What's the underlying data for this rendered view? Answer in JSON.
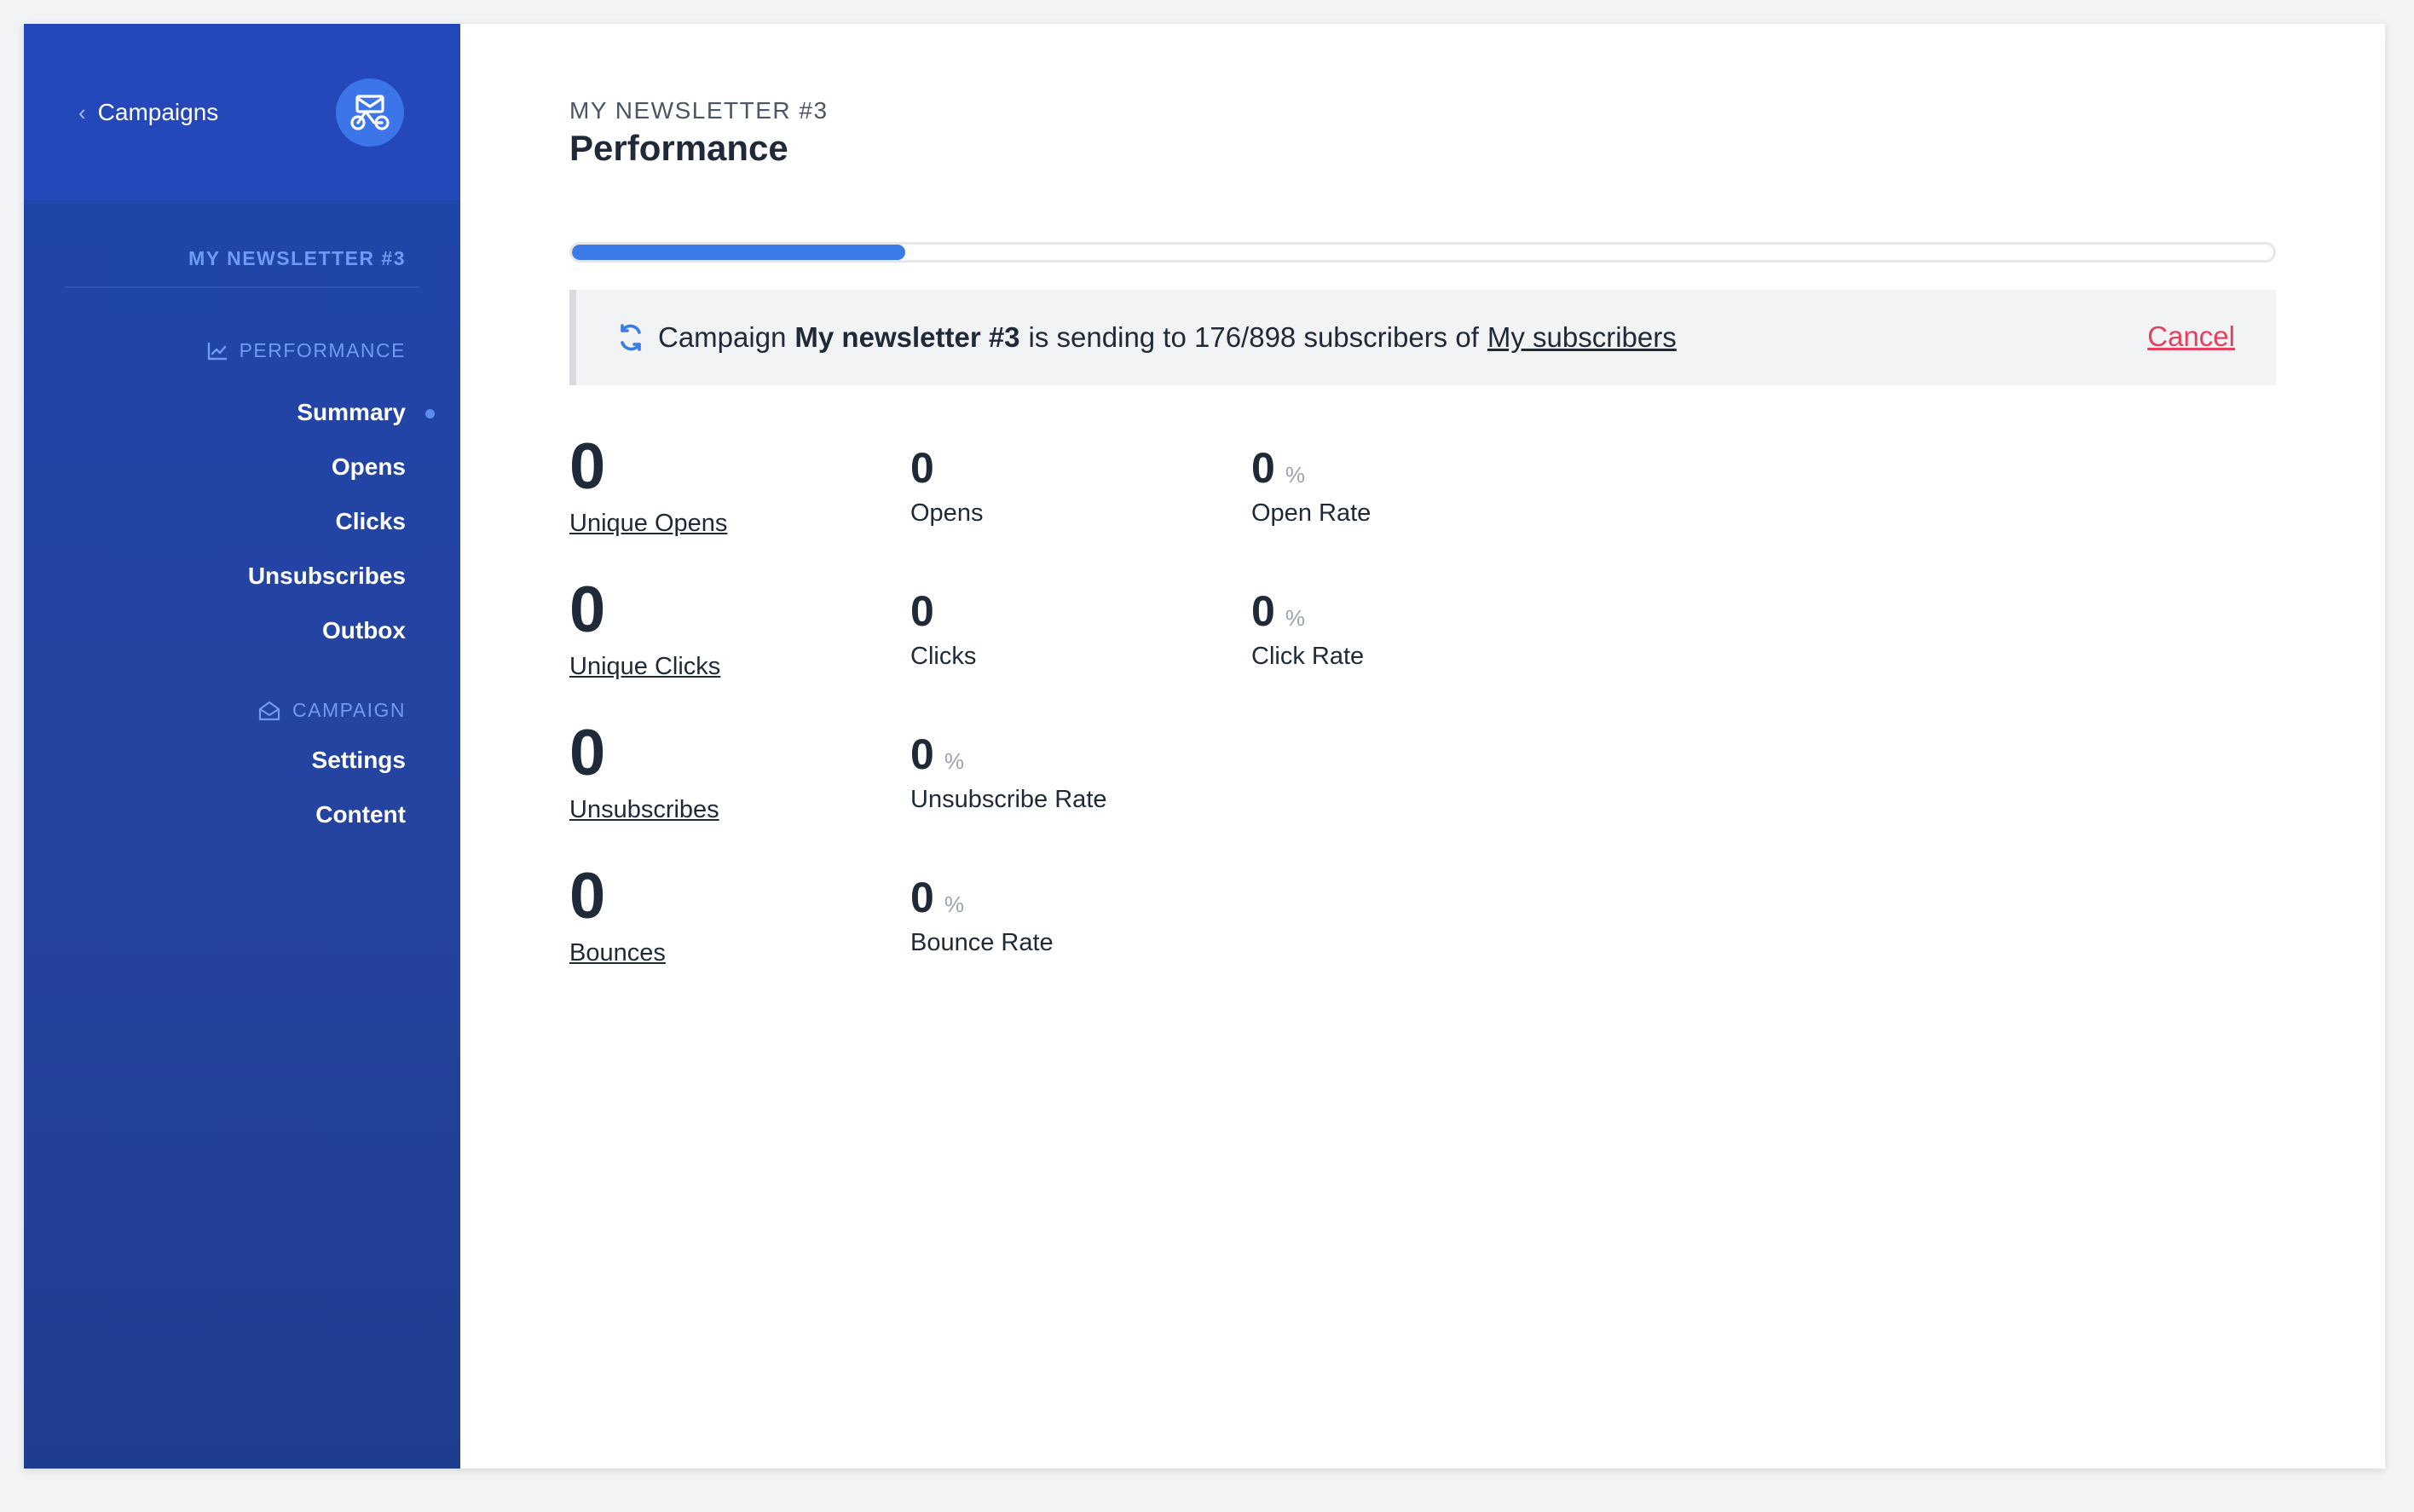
{
  "sidebar": {
    "back_label": "Campaigns",
    "newsletter_name": "MY NEWSLETTER #3",
    "sections": [
      {
        "title": "PERFORMANCE",
        "items": [
          {
            "label": "Summary",
            "active": true
          },
          {
            "label": "Opens"
          },
          {
            "label": "Clicks"
          },
          {
            "label": "Unsubscribes"
          },
          {
            "label": "Outbox"
          }
        ]
      },
      {
        "title": "CAMPAIGN",
        "items": [
          {
            "label": "Settings"
          },
          {
            "label": "Content"
          }
        ]
      }
    ]
  },
  "header": {
    "eyebrow": "MY NEWSLETTER #3",
    "title": "Performance"
  },
  "progress": {
    "sent": 176,
    "total": 898,
    "fraction": 0.196
  },
  "alert": {
    "prefix": "Campaign",
    "campaign_name": "My newsletter #3",
    "middle": "is sending to 176/898 subscribers of",
    "list_name": "My subscribers",
    "cancel_label": "Cancel"
  },
  "stats": {
    "unique_opens": {
      "value": "0",
      "label": "Unique Opens"
    },
    "opens": {
      "value": "0",
      "label": "Opens"
    },
    "open_rate": {
      "value": "0",
      "unit": "%",
      "label": "Open Rate"
    },
    "unique_clicks": {
      "value": "0",
      "label": "Unique Clicks"
    },
    "clicks": {
      "value": "0",
      "label": "Clicks"
    },
    "click_rate": {
      "value": "0",
      "unit": "%",
      "label": "Click Rate"
    },
    "unsubscribes": {
      "value": "0",
      "label": "Unsubscribes"
    },
    "unsubscribe_rate": {
      "value": "0",
      "unit": "%",
      "label": "Unsubscribe Rate"
    },
    "bounces": {
      "value": "0",
      "label": "Bounces"
    },
    "bounce_rate": {
      "value": "0",
      "unit": "%",
      "label": "Bounce Rate"
    }
  },
  "colors": {
    "sidebar": "#1e45ac",
    "accent": "#3b7be8",
    "danger": "#e5405e"
  },
  "icons": [
    "chevron-left-icon",
    "logo-icon",
    "chart-icon",
    "envelope-open-icon",
    "sync-icon"
  ]
}
